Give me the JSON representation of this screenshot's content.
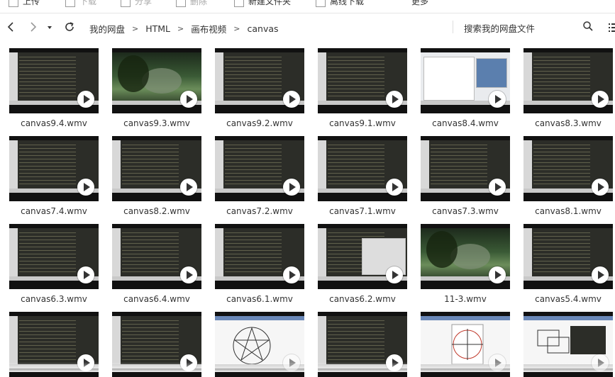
{
  "toolbar": {
    "items": [
      {
        "label": "上传",
        "icon": "upload-icon",
        "enabled": true
      },
      {
        "label": "下载",
        "icon": "download-icon",
        "enabled": false
      },
      {
        "label": "分享",
        "icon": "share-icon",
        "enabled": false
      },
      {
        "label": "删除",
        "icon": "trash-icon",
        "enabled": false
      },
      {
        "label": "新建文件夹",
        "icon": "new-folder-icon",
        "enabled": true
      },
      {
        "label": "离线下载",
        "icon": "offline-download-icon",
        "enabled": true
      },
      {
        "label": "更多",
        "icon": "more-icon",
        "enabled": true
      }
    ]
  },
  "nav": {
    "back": "<",
    "forward": ">",
    "history": "▾",
    "refresh": "↻"
  },
  "breadcrumb": {
    "items": [
      "我的网盘",
      "HTML",
      "画布视频",
      "canvas"
    ],
    "separator": ">"
  },
  "search": {
    "placeholder": "搜索我的网盘文件"
  },
  "files": [
    {
      "name": "canvas9.4.wmv",
      "style": "code"
    },
    {
      "name": "canvas9.3.wmv",
      "style": "photo"
    },
    {
      "name": "canvas9.2.wmv",
      "style": "code"
    },
    {
      "name": "canvas9.1.wmv",
      "style": "code"
    },
    {
      "name": "canvas8.4.wmv",
      "style": "light"
    },
    {
      "name": "canvas8.3.wmv",
      "style": "code"
    },
    {
      "name": "canvas7.4.wmv",
      "style": "code"
    },
    {
      "name": "canvas8.2.wmv",
      "style": "code"
    },
    {
      "name": "canvas7.2.wmv",
      "style": "code"
    },
    {
      "name": "canvas7.1.wmv",
      "style": "code"
    },
    {
      "name": "canvas7.3.wmv",
      "style": "code"
    },
    {
      "name": "canvas8.1.wmv",
      "style": "code"
    },
    {
      "name": "canvas6.3.wmv",
      "style": "code"
    },
    {
      "name": "canvas6.4.wmv",
      "style": "code"
    },
    {
      "name": "canvas6.1.wmv",
      "style": "code"
    },
    {
      "name": "canvas6.2.wmv",
      "style": "split"
    },
    {
      "name": "11-3.wmv",
      "style": "photo"
    },
    {
      "name": "canvas5.4.wmv",
      "style": "code"
    },
    {
      "name": "",
      "style": "code"
    },
    {
      "name": "",
      "style": "code"
    },
    {
      "name": "",
      "style": "drawing-star"
    },
    {
      "name": "",
      "style": "code"
    },
    {
      "name": "",
      "style": "drawing-clock"
    },
    {
      "name": "",
      "style": "drawing-shapes"
    }
  ],
  "colors": {
    "code_bg": "#2c2d28",
    "text": "#333333",
    "thumb_frame": "#111111"
  }
}
